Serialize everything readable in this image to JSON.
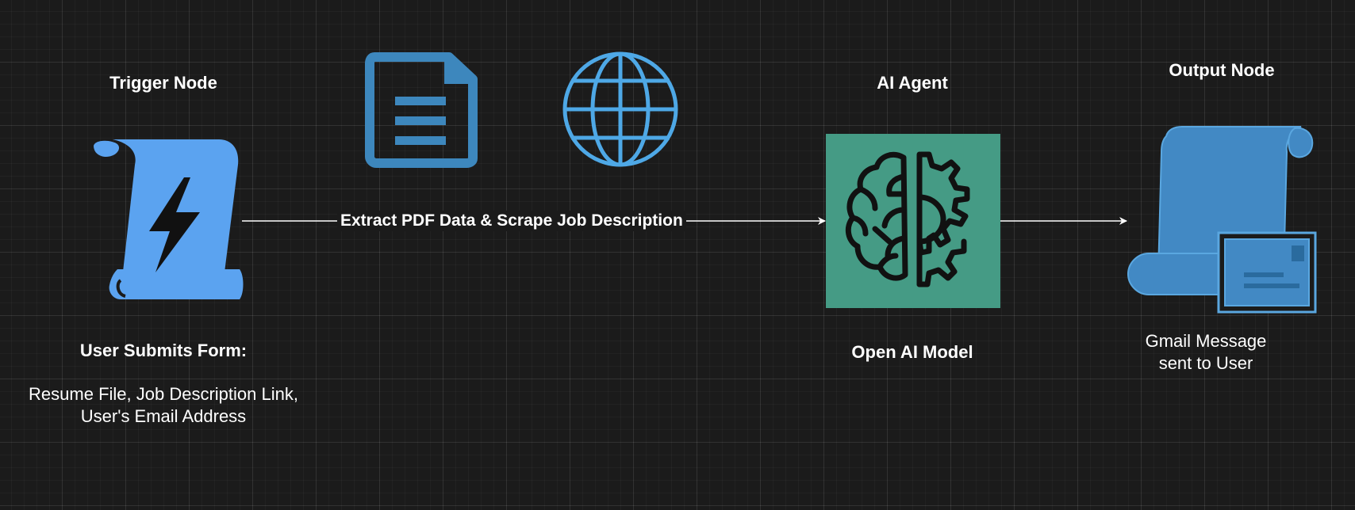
{
  "diagram": {
    "trigger": {
      "heading": "Trigger Node",
      "caption_title": "User Submits Form:",
      "caption_line1": "Resume File, Job Description Link,",
      "caption_line2": "User's Email Address"
    },
    "extract_label": "Extract PDF Data & Scrape Job Description",
    "agent": {
      "heading": "AI Agent",
      "caption": "Open AI Model"
    },
    "output": {
      "heading": "Output Node",
      "caption_line1": "Gmail Message",
      "caption_line2": "sent to User"
    },
    "colors": {
      "background": "#1b1b1b",
      "trigger_icon": "#5ba3f0",
      "document_icon": "#3d87bd",
      "globe_icon": "#4ea8e6",
      "agent_box": "#459b85",
      "output_icon": "#4289c4",
      "connector": "#ffffff"
    },
    "icons": [
      "scroll-lightning-icon",
      "document-icon",
      "globe-icon",
      "brain-gear-icon",
      "scroll-envelope-icon"
    ]
  }
}
